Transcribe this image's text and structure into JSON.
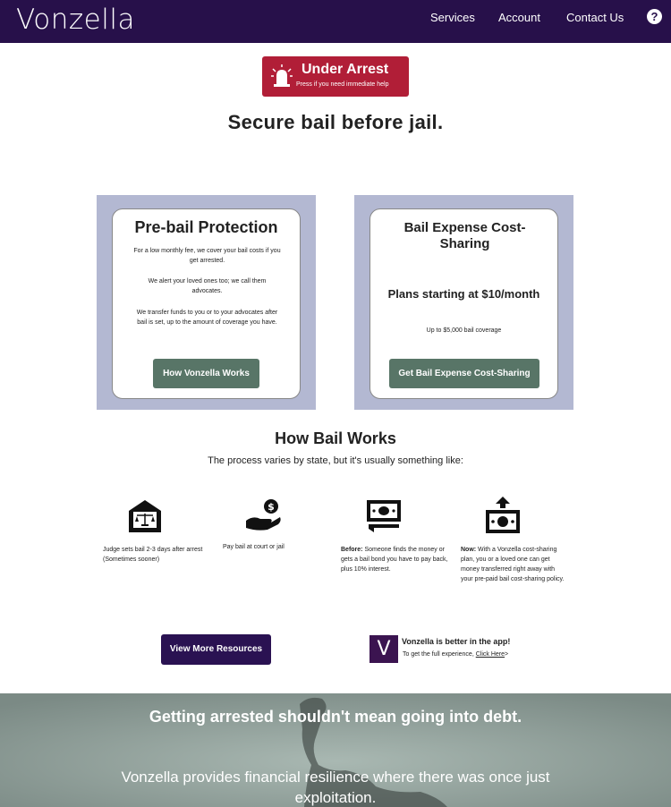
{
  "header": {
    "logo": "Vonzella",
    "nav": [
      "Services",
      "Account",
      "Contact Us"
    ],
    "help": "?"
  },
  "colors": {
    "header_bg": "#27104a",
    "alert_red": "#b11e37",
    "card_frame": "#b3b8d2",
    "button_green": "#587567",
    "button_purple": "#2a1252"
  },
  "arrest": {
    "title": "Under Arrest",
    "subtitle": "Press if you need immediate help",
    "icon": "siren-icon"
  },
  "hero": {
    "title": "Secure bail before jail."
  },
  "cards": {
    "left": {
      "title": "Pre-bail Protection",
      "lines": [
        "For a low monthly fee, we cover your bail costs if you get arrested.",
        "We alert your loved ones too; we call them advocates.",
        "We transfer funds to you or to your advocates after bail is set, up to the amount of coverage you have."
      ],
      "button": "How Vonzella Works"
    },
    "right": {
      "title": "Bail Expense Cost-Sharing",
      "price": "Plans starting at $10/month",
      "coverage": "Up to $5,000 bail coverage",
      "button": "Get Bail Expense Cost-Sharing"
    }
  },
  "how_bail_works": {
    "title": "How Bail Works",
    "subtitle": "The process varies by state, but it's usually something like:",
    "steps": [
      {
        "icon": "courthouse-scales-icon",
        "text": "Judge sets bail 2-3 days after arrest (Sometimes sooner)"
      },
      {
        "icon": "hand-coin-icon",
        "text": "Pay bail at court or jail"
      },
      {
        "icon": "cash-stack-icon",
        "label": "Before:",
        "text": " Someone finds the money or gets a bail bond you have to pay back, plus 10% interest."
      },
      {
        "icon": "cash-transfer-icon",
        "label": "Now:",
        "text": " With a Vonzella cost-sharing plan, you or a loved one can get money transferred right away with your pre-paid bail cost-sharing policy."
      }
    ]
  },
  "resources_button": "View More Resources",
  "app_promo": {
    "logo_letter": "V",
    "title": "Vonzella is better in the app!",
    "prefix": "To get the full experience,",
    "link": "Click Here",
    "suffix": ">"
  },
  "banner": {
    "title": "Getting arrested shouldn't mean going into debt.",
    "text": "Vonzella provides financial resilience where there was once just exploitation."
  }
}
